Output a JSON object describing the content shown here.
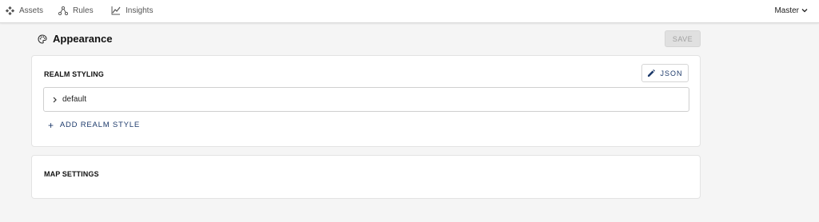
{
  "nav": {
    "items": [
      {
        "label": "Assets",
        "icon": "assets-icon"
      },
      {
        "label": "Rules",
        "icon": "rules-icon"
      },
      {
        "label": "Insights",
        "icon": "insights-icon"
      }
    ],
    "realm": "Master"
  },
  "page": {
    "title": "Appearance",
    "save_label": "SAVE"
  },
  "realm_styling": {
    "title": "REALM STYLING",
    "json_label": "JSON",
    "styles": [
      {
        "label": "default"
      }
    ],
    "add_label": "ADD REALM STYLE"
  },
  "map_settings": {
    "title": "MAP SETTINGS"
  },
  "colors": {
    "accent": "#1d3a6b",
    "background": "#f5f5f5",
    "disabled": "#e0e0e0"
  }
}
